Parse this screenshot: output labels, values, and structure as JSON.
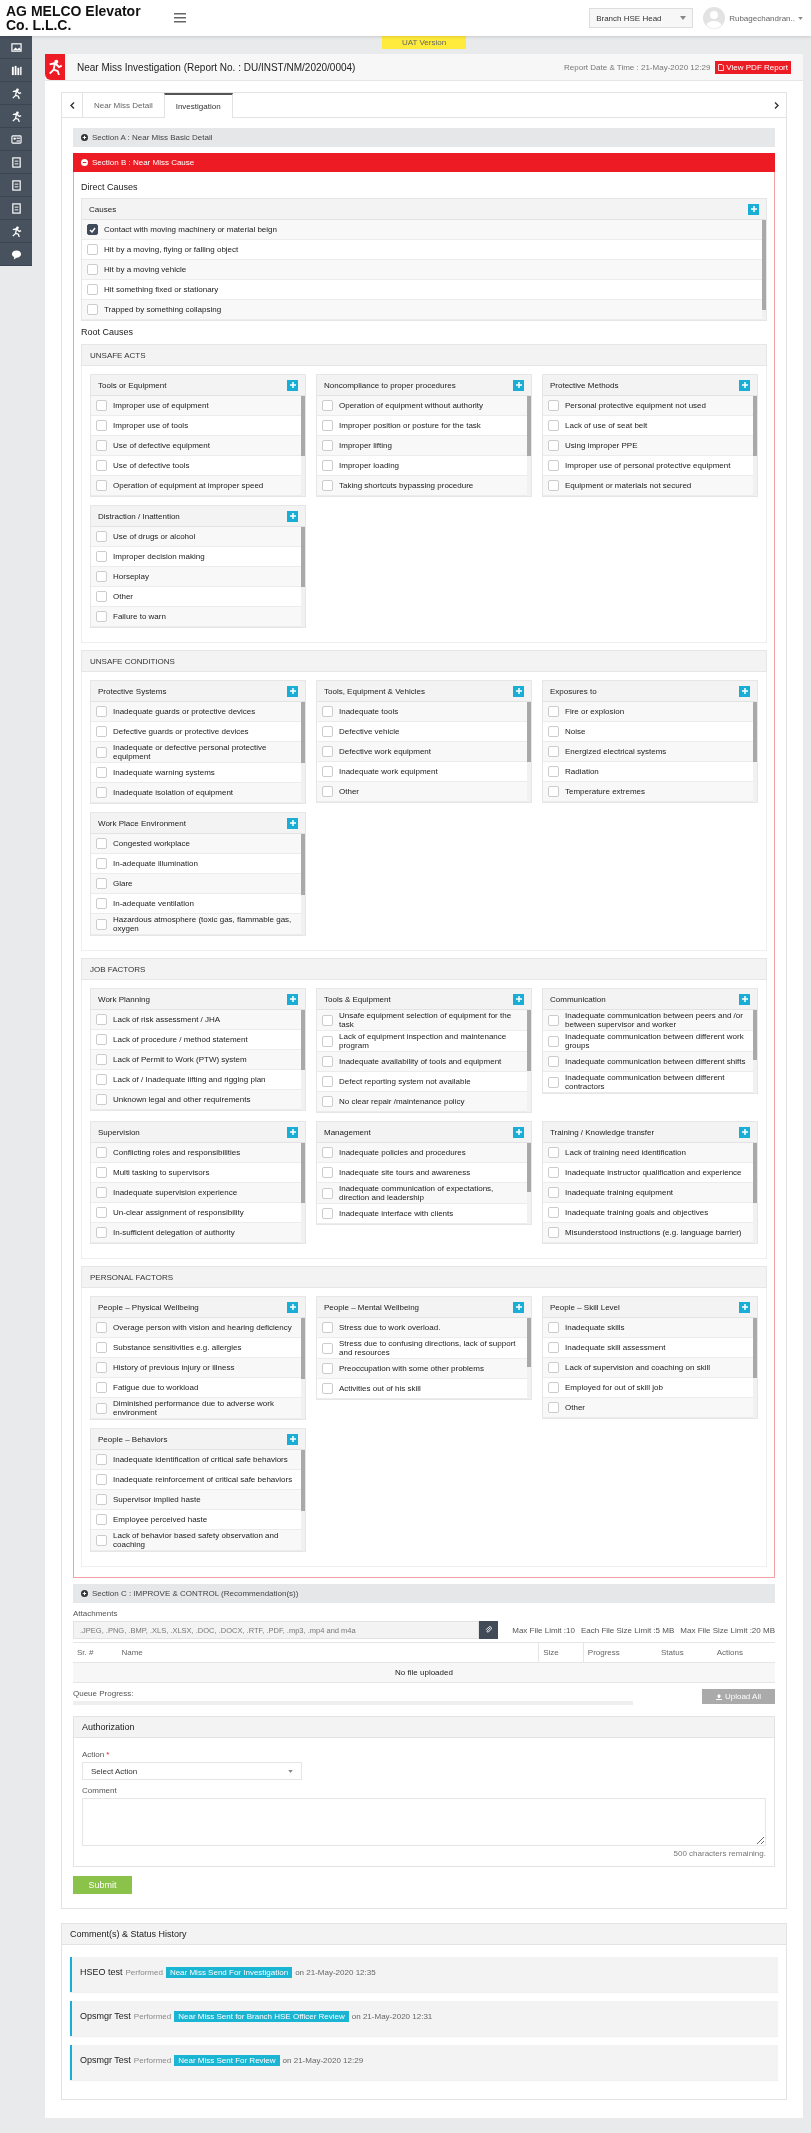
{
  "header": {
    "company": "AG MELCO Elevator Co. L.L.C.",
    "role": "Branch HSE Head",
    "user": "Rubagechandran.."
  },
  "banner": "UAT Version",
  "report": {
    "title": "Near Miss Investigation (Report No. : DU/INST/NM/2020/0004)",
    "date": "Report Date & Time : 21-May-2020 12:29",
    "pdf_button": "View PDF Report"
  },
  "tabs": [
    {
      "label": "Near Miss Detail",
      "selected": false
    },
    {
      "label": "Investigation",
      "selected": true
    }
  ],
  "section_a": {
    "title": "Section A : Near Miss Basic Detail",
    "expanded": false
  },
  "section_b": {
    "title": "Section B : Near Miss Cause",
    "expanded": true,
    "direct_causes": {
      "heading": "Direct Causes",
      "title": "Causes",
      "items": [
        {
          "label": "Contact with moving machinery or material beign",
          "checked": true
        },
        {
          "label": "Hit by a moving, flying or falling object",
          "checked": false
        },
        {
          "label": "Hit by a moving vehicle",
          "checked": false
        },
        {
          "label": "Hit something fixed or stationary",
          "checked": false
        },
        {
          "label": "Trapped by something collapsing",
          "checked": false
        }
      ]
    },
    "root_causes": {
      "heading": "Root Causes",
      "groups": [
        {
          "title": "UNSAFE ACTS",
          "lists": [
            {
              "title": "Tools or Equipment",
              "items": [
                {
                  "label": "Improper use of equipment",
                  "checked": false
                },
                {
                  "label": "Improper use of tools",
                  "checked": false
                },
                {
                  "label": "Use of defective equipment",
                  "checked": false
                },
                {
                  "label": "Use of defective tools",
                  "checked": false
                },
                {
                  "label": "Operation of equipment at improper speed",
                  "checked": false
                }
              ]
            },
            {
              "title": "Noncompliance to proper procedures",
              "items": [
                {
                  "label": "Operation of equipment without authority",
                  "checked": false
                },
                {
                  "label": "Improper position or posture for the task",
                  "checked": false
                },
                {
                  "label": "Improper lifting",
                  "checked": false
                },
                {
                  "label": "Improper loading",
                  "checked": false
                },
                {
                  "label": "Taking shortcuts bypassing procedure",
                  "checked": false
                }
              ]
            },
            {
              "title": "Protective Methods",
              "items": [
                {
                  "label": "Personal protective equipment not used",
                  "checked": false
                },
                {
                  "label": "Lack of use of seat belt",
                  "checked": false
                },
                {
                  "label": "Using improper PPE",
                  "checked": false
                },
                {
                  "label": "Improper use of personal protective equipment",
                  "checked": false
                },
                {
                  "label": "Equipment or materials not secured",
                  "checked": false
                }
              ]
            },
            {
              "title": "Distraction / Inattention",
              "items": [
                {
                  "label": "Use of drugs or alcohol",
                  "checked": false
                },
                {
                  "label": "Improper decision making",
                  "checked": false
                },
                {
                  "label": "Horseplay",
                  "checked": false
                },
                {
                  "label": "Other",
                  "checked": false
                },
                {
                  "label": "Failure to warn",
                  "checked": false
                }
              ]
            }
          ]
        },
        {
          "title": "UNSAFE CONDITIONS",
          "lists": [
            {
              "title": "Protective Systems",
              "items": [
                {
                  "label": "Inadequate guards or protective devices",
                  "checked": false
                },
                {
                  "label": "Defective guards or protective devices",
                  "checked": false
                },
                {
                  "label": "Inadequate or defective personal protective equipment",
                  "checked": false
                },
                {
                  "label": "Inadequate warning systems",
                  "checked": false
                },
                {
                  "label": "Inadequate isolation of equipment",
                  "checked": false
                }
              ]
            },
            {
              "title": "Tools, Equipment & Vehicles",
              "items": [
                {
                  "label": "Inadequate tools",
                  "checked": false
                },
                {
                  "label": "Defective vehicle",
                  "checked": false
                },
                {
                  "label": "Defective work equipment",
                  "checked": false
                },
                {
                  "label": "Inadequate work equipment",
                  "checked": false
                },
                {
                  "label": "Other",
                  "checked": false
                }
              ]
            },
            {
              "title": "Exposures to",
              "items": [
                {
                  "label": "Fire or explosion",
                  "checked": false
                },
                {
                  "label": "Noise",
                  "checked": false
                },
                {
                  "label": "Energized electrical systems",
                  "checked": false
                },
                {
                  "label": "Radiation",
                  "checked": false
                },
                {
                  "label": "Temperature extremes",
                  "checked": false
                }
              ]
            },
            {
              "title": "Work Place Environment",
              "items": [
                {
                  "label": "Congested workplace",
                  "checked": false
                },
                {
                  "label": "In-adequate illumination",
                  "checked": false
                },
                {
                  "label": "Glare",
                  "checked": false
                },
                {
                  "label": "In-adequate ventilation",
                  "checked": false
                },
                {
                  "label": "Hazardous atmosphere (toxic gas, flammable gas, oxygen",
                  "checked": false
                }
              ]
            }
          ]
        },
        {
          "title": "JOB FACTORS",
          "lists": [
            {
              "title": "Work Planning",
              "items": [
                {
                  "label": "Lack of risk assessment / JHA",
                  "checked": false
                },
                {
                  "label": "Lack of procedure / method statement",
                  "checked": false
                },
                {
                  "label": "Lack of Permit to Work (PTW) system",
                  "checked": false
                },
                {
                  "label": "Lack of / Inadequate lifting and rigging plan",
                  "checked": false
                },
                {
                  "label": "Unknown legal and other requirements",
                  "checked": false
                }
              ]
            },
            {
              "title": "Tools & Equipment",
              "items": [
                {
                  "label": "Unsafe equipment selection of equipment for the task",
                  "checked": false
                },
                {
                  "label": "Lack of equipment inspection and maintenance program",
                  "checked": false
                },
                {
                  "label": "Inadequate availability of tools and equipment",
                  "checked": false
                },
                {
                  "label": "Defect reporting system not available",
                  "checked": false
                },
                {
                  "label": "No clear repair /maintenance policy",
                  "checked": false
                }
              ]
            },
            {
              "title": "Communication",
              "items": [
                {
                  "label": "Inadequate communication between peers and /or between supervisor and worker",
                  "checked": false
                },
                {
                  "label": "Inadequate communication between different work groups",
                  "checked": false
                },
                {
                  "label": "Inadequate communication between different shifts",
                  "checked": false
                },
                {
                  "label": "Inadequate communication between different contractors",
                  "checked": false
                }
              ]
            },
            {
              "title": "Supervision",
              "items": [
                {
                  "label": "Conflicting roles and responsibilities",
                  "checked": false
                },
                {
                  "label": "Multi tasking to supervisors",
                  "checked": false
                },
                {
                  "label": "Inadequate supervision experience",
                  "checked": false
                },
                {
                  "label": "Un-clear assignment of responsibility",
                  "checked": false
                },
                {
                  "label": "In-sufficient delegation of authority",
                  "checked": false
                }
              ]
            },
            {
              "title": "Management",
              "items": [
                {
                  "label": "Inadequate policies and procedures",
                  "checked": false
                },
                {
                  "label": "Inadequate site tours and awareness",
                  "checked": false
                },
                {
                  "label": "Inadequate communication of expectations, direction and leadership",
                  "checked": false
                },
                {
                  "label": "Inadequate interface with clients",
                  "checked": false
                }
              ]
            },
            {
              "title": "Training / Knowledge transfer",
              "items": [
                {
                  "label": "Lack of training need identification",
                  "checked": false
                },
                {
                  "label": "Inadequate instructor qualification and experience",
                  "checked": false
                },
                {
                  "label": "Inadequate training equipment",
                  "checked": false
                },
                {
                  "label": "Inadequate training goals and objectives",
                  "checked": false
                },
                {
                  "label": "Misunderstood instructions (e.g. language barrier)",
                  "checked": false
                }
              ]
            }
          ]
        },
        {
          "title": "PERSONAL FACTORS",
          "lists": [
            {
              "title": "People – Physical Wellbeing",
              "items": [
                {
                  "label": "Overage person with vision and hearing deficiency",
                  "checked": false
                },
                {
                  "label": "Substance sensitivities e.g. allergies",
                  "checked": false
                },
                {
                  "label": "History of previous injury or illness",
                  "checked": false
                },
                {
                  "label": "Fatigue due to workload",
                  "checked": false
                },
                {
                  "label": "Diminished performance due to adverse work environment",
                  "checked": false
                }
              ]
            },
            {
              "title": "People – Mental Wellbeing",
              "items": [
                {
                  "label": "Stress due to work overload.",
                  "checked": false
                },
                {
                  "label": "Stress due to confusing directions, lack of support and resources",
                  "checked": false
                },
                {
                  "label": "Preoccupation with some other problems",
                  "checked": false
                },
                {
                  "label": "Activities out of his skill",
                  "checked": false
                }
              ]
            },
            {
              "title": "People – Skill Level",
              "items": [
                {
                  "label": "Inadequate skills",
                  "checked": false
                },
                {
                  "label": "Inadequate skill assessment",
                  "checked": false
                },
                {
                  "label": "Lack of supervision and coaching on skill",
                  "checked": false
                },
                {
                  "label": "Employed for out of skill job",
                  "checked": false
                },
                {
                  "label": "Other",
                  "checked": false
                }
              ]
            },
            {
              "title": "People – Behaviors",
              "items": [
                {
                  "label": "Inadequate identification of critical safe behaviors",
                  "checked": false
                },
                {
                  "label": "Inadequate reinforcement of critical safe behaviors",
                  "checked": false
                },
                {
                  "label": "Supervisor implied haste",
                  "checked": false
                },
                {
                  "label": "Employee perceived haste",
                  "checked": false
                },
                {
                  "label": "Lack of behavior based safety observation and coaching",
                  "checked": false
                }
              ]
            }
          ]
        }
      ]
    }
  },
  "section_c": {
    "title": "Section C : IMPROVE & CONTROL (Recommendation(s))",
    "expanded": false
  },
  "attachments": {
    "label": "Attachments",
    "placeholder": ".JPEG, .PNG, .BMP, .XLS, .XLSX, .DOC, .DOCX, .RTF, .PDF, .mp3, .mp4 and m4a",
    "limits": [
      "Max File Limit :10",
      "Each File Size Limit :5 MB",
      "Max File Size Limit :20 MB"
    ],
    "columns": [
      "Sr. #",
      "Name",
      "Size",
      "Progress",
      "Status",
      "Actions"
    ],
    "empty": "No file uploaded",
    "queue_label": "Queue Progress:",
    "queue": {
      "level": 0
    },
    "upload_button": {
      "label": "Upload All",
      "disabled": true
    }
  },
  "authorization": {
    "title": "Authorization",
    "action_label": "Action",
    "required_mark": "*",
    "action_value": "Select Action",
    "comment_label": "Comment",
    "remaining": "500 characters remaining.",
    "submit": "Submit"
  },
  "history": {
    "title": "Comment(s) & Status History",
    "entries": [
      {
        "user": "HSEO test",
        "verb": "Performed",
        "status": "Near Miss Send For Investigation",
        "time": "on 21-May-2020 12:35"
      },
      {
        "user": "Opsmgr Test",
        "verb": "Performed",
        "status": "Near Miss Sent for Branch HSE Officer Review",
        "time": "on 21-May-2020 12:31"
      },
      {
        "user": "Opsmgr Test",
        "verb": "Performed",
        "status": "Near Miss Sent For Review",
        "time": "on 21-May-2020 12:29"
      }
    ]
  }
}
